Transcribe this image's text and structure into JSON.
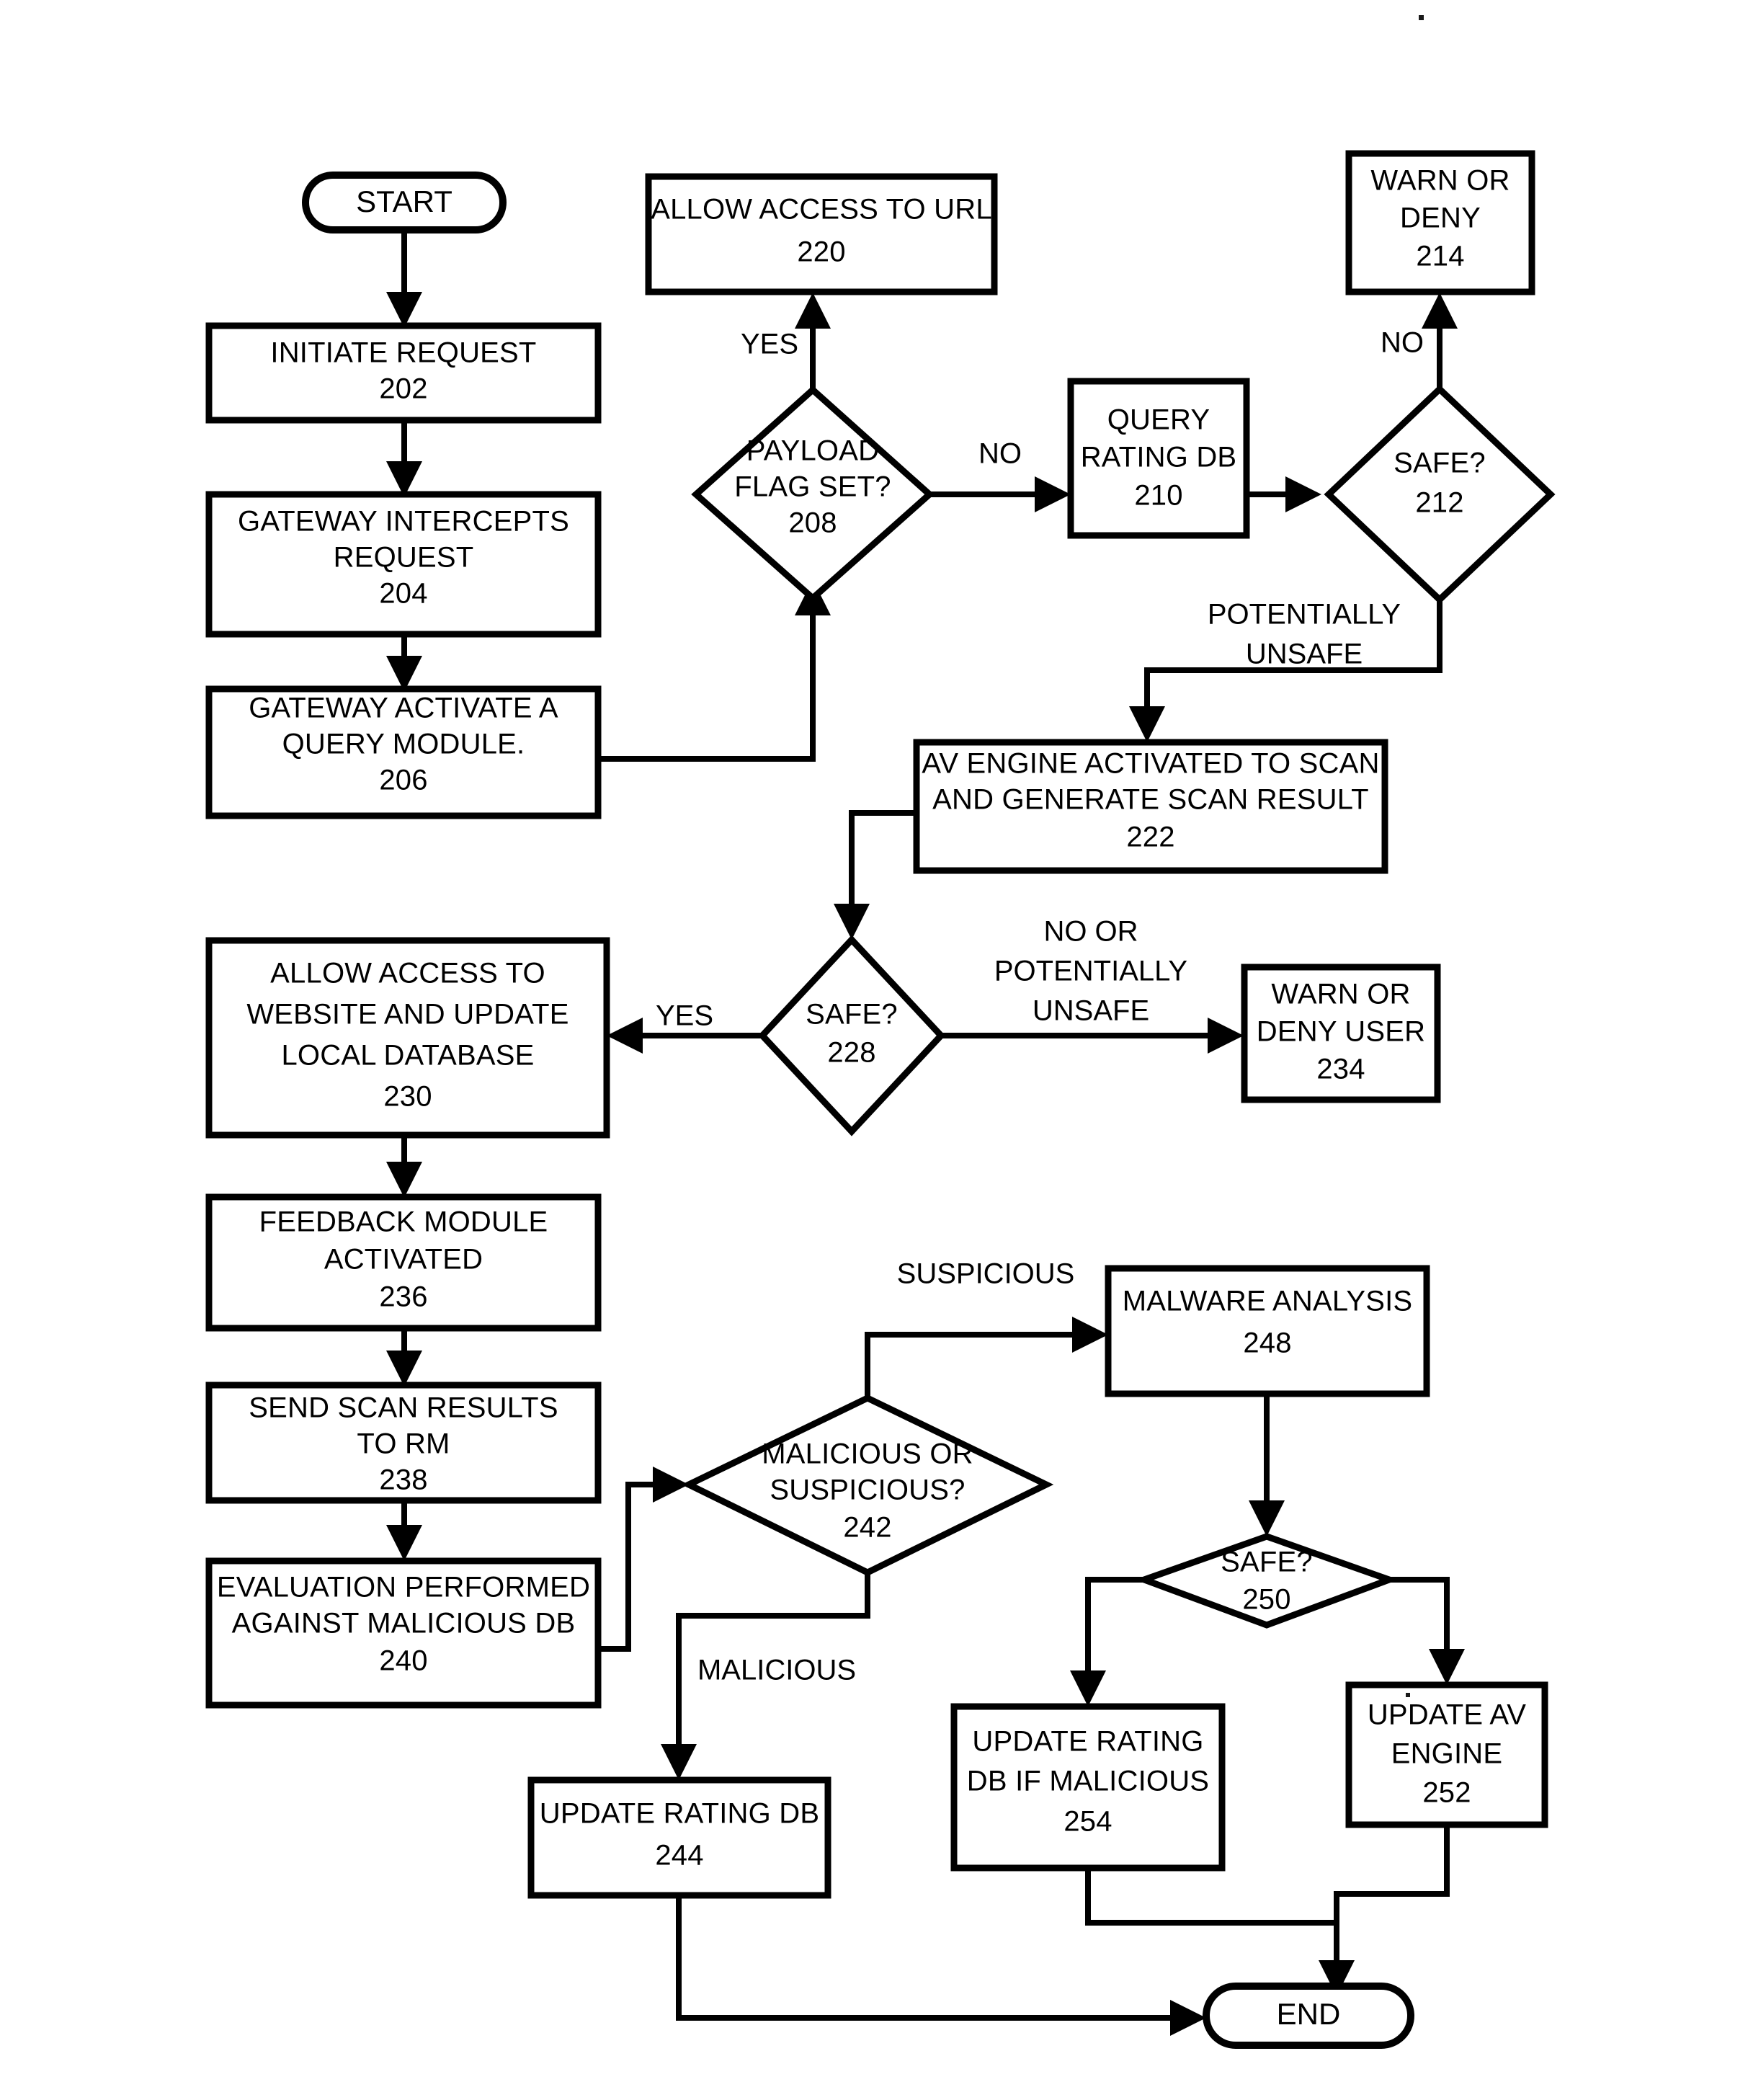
{
  "diagram": {
    "type": "flowchart",
    "title": "URL request security screening flowchart",
    "nodes": [
      {
        "id": "start",
        "shape": "terminator",
        "lines": [
          "START"
        ],
        "ref": ""
      },
      {
        "id": "n202",
        "shape": "process",
        "lines": [
          "INITIATE REQUEST"
        ],
        "ref": "202"
      },
      {
        "id": "n204",
        "shape": "process",
        "lines": [
          "GATEWAY INTERCEPTS",
          "REQUEST"
        ],
        "ref": "204"
      },
      {
        "id": "n206",
        "shape": "process",
        "lines": [
          "GATEWAY ACTIVATE A",
          "QUERY MODULE."
        ],
        "ref": "206"
      },
      {
        "id": "n208",
        "shape": "decision",
        "lines": [
          "PAYLOAD",
          "FLAG SET?"
        ],
        "ref": "208"
      },
      {
        "id": "n220",
        "shape": "process",
        "lines": [
          "ALLOW ACCESS TO URL"
        ],
        "ref": "220"
      },
      {
        "id": "n210",
        "shape": "process",
        "lines": [
          "QUERY",
          "RATING DB"
        ],
        "ref": "210"
      },
      {
        "id": "n212",
        "shape": "decision",
        "lines": [
          "SAFE?"
        ],
        "ref": "212"
      },
      {
        "id": "n214",
        "shape": "process",
        "lines": [
          "WARN OR",
          "DENY"
        ],
        "ref": "214"
      },
      {
        "id": "n222",
        "shape": "process",
        "lines": [
          "AV ENGINE ACTIVATED TO SCAN",
          "AND GENERATE SCAN RESULT"
        ],
        "ref": "222"
      },
      {
        "id": "n228",
        "shape": "decision",
        "lines": [
          "SAFE?"
        ],
        "ref": "228"
      },
      {
        "id": "n230",
        "shape": "process",
        "lines": [
          "ALLOW ACCESS TO",
          "WEBSITE AND UPDATE",
          "LOCAL DATABASE"
        ],
        "ref": "230"
      },
      {
        "id": "n234",
        "shape": "process",
        "lines": [
          "WARN OR",
          "DENY USER"
        ],
        "ref": "234"
      },
      {
        "id": "n236",
        "shape": "process",
        "lines": [
          "FEEDBACK MODULE",
          "ACTIVATED"
        ],
        "ref": "236"
      },
      {
        "id": "n238",
        "shape": "process",
        "lines": [
          "SEND SCAN RESULTS",
          "TO RM"
        ],
        "ref": "238"
      },
      {
        "id": "n240",
        "shape": "process",
        "lines": [
          "EVALUATION PERFORMED",
          "AGAINST MALICIOUS DB"
        ],
        "ref": "240"
      },
      {
        "id": "n242",
        "shape": "decision",
        "lines": [
          "MALICIOUS OR",
          "SUSPICIOUS?"
        ],
        "ref": "242"
      },
      {
        "id": "n248",
        "shape": "process",
        "lines": [
          "MALWARE ANALYSIS"
        ],
        "ref": "248"
      },
      {
        "id": "n250",
        "shape": "decision",
        "lines": [
          "SAFE?"
        ],
        "ref": "250"
      },
      {
        "id": "n244",
        "shape": "process",
        "lines": [
          "UPDATE RATING DB"
        ],
        "ref": "244"
      },
      {
        "id": "n254",
        "shape": "process",
        "lines": [
          "UPDATE RATING",
          "DB IF MALICIOUS"
        ],
        "ref": "254"
      },
      {
        "id": "n252",
        "shape": "process",
        "lines": [
          "UPDATE AV",
          "ENGINE"
        ],
        "ref": "252"
      },
      {
        "id": "end",
        "shape": "terminator",
        "lines": [
          "END"
        ],
        "ref": ""
      }
    ],
    "edge_labels": {
      "e208_yes": "YES",
      "e208_no": "NO",
      "e212_no": "NO",
      "e212_unsafe_l1": "POTENTIALLY",
      "e212_unsafe_l2": "UNSAFE",
      "e228_yes": "YES",
      "e228_unsafe_l1": "NO OR",
      "e228_unsafe_l2": "POTENTIALLY",
      "e228_unsafe_l3": "UNSAFE",
      "e242_suspicious": "SUSPICIOUS",
      "e242_malicious": "MALICIOUS"
    },
    "colors": {
      "stroke": "#000000",
      "fill": "#ffffff",
      "background": "#ffffff"
    }
  }
}
